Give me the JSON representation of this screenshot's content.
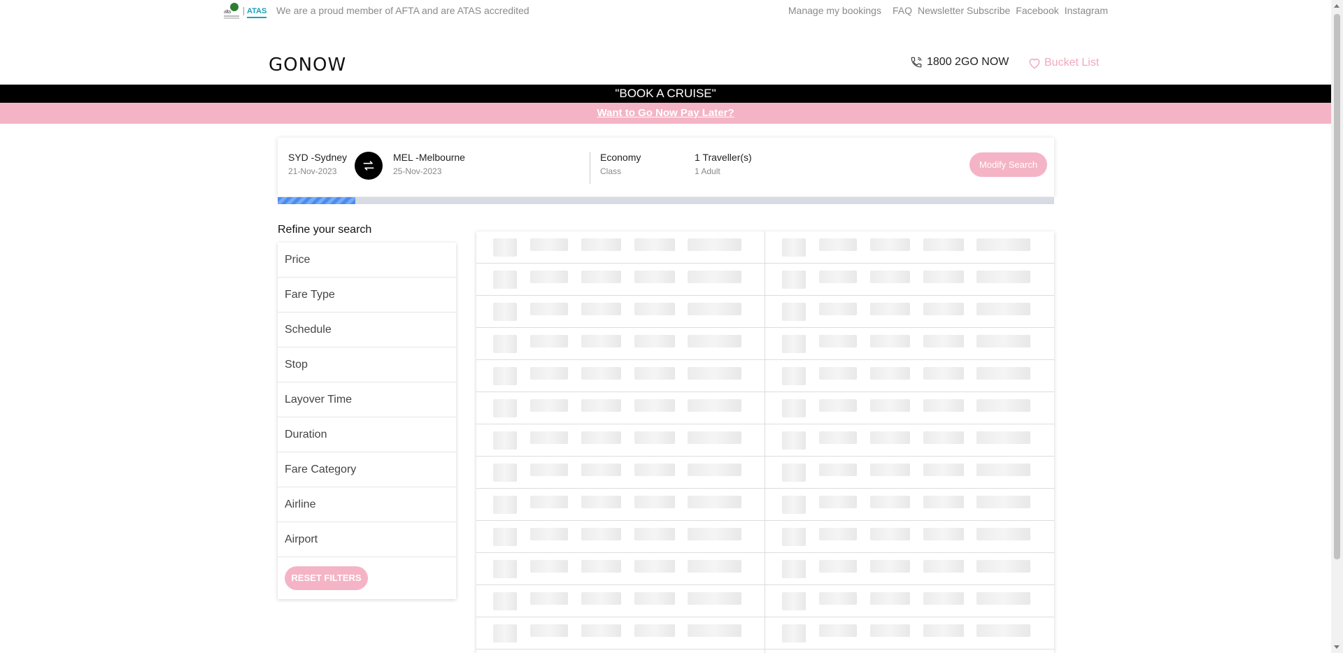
{
  "topbar": {
    "afta_logo_text": "afta",
    "atas_logo_text": "ATAS",
    "accreditation": "We are a proud member of AFTA and are ATAS accredited",
    "links": [
      "Manage my bookings",
      "FAQ",
      "Newsletter Subscribe",
      "Facebook",
      "Instagram"
    ]
  },
  "header": {
    "brand": "GONOW",
    "phone": "1800 2GO NOW",
    "bucket_list": "Bucket List"
  },
  "banners": {
    "black": "\"BOOK A CRUISE\"",
    "pink": "Want to Go Now Pay Later?"
  },
  "search": {
    "origin": "SYD -Sydney",
    "depart_date": "21-Nov-2023",
    "destination": "MEL -Melbourne",
    "return_date": "25-Nov-2023",
    "cabin": "Economy",
    "cabin_sub": "Class",
    "travellers": "1 Traveller(s)",
    "travellers_sub": "1 Adult",
    "modify_label": "Modify Search",
    "progress_fraction": 0.1
  },
  "refine": {
    "title": "Refine your search",
    "filters": [
      "Price",
      "Fare Type",
      "Schedule",
      "Stop",
      "Layover Time",
      "Duration",
      "Fare Category",
      "Airline",
      "Airport"
    ],
    "reset_label": "RESET FILTERS"
  },
  "colors": {
    "accent_pink": "#f4b4c5",
    "banner_black": "#000000",
    "progress_blue": "#4a8df0"
  }
}
